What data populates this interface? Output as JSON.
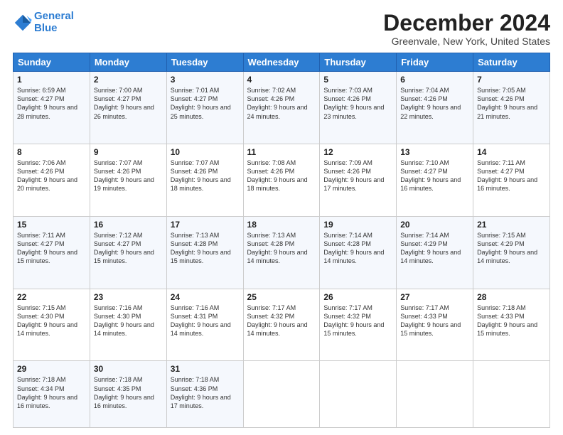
{
  "header": {
    "logo_line1": "General",
    "logo_line2": "Blue",
    "title": "December 2024",
    "subtitle": "Greenvale, New York, United States"
  },
  "weekdays": [
    "Sunday",
    "Monday",
    "Tuesday",
    "Wednesday",
    "Thursday",
    "Friday",
    "Saturday"
  ],
  "weeks": [
    [
      {
        "day": "1",
        "sunrise": "6:59 AM",
        "sunset": "4:27 PM",
        "daylight": "9 hours and 28 minutes."
      },
      {
        "day": "2",
        "sunrise": "7:00 AM",
        "sunset": "4:27 PM",
        "daylight": "9 hours and 26 minutes."
      },
      {
        "day": "3",
        "sunrise": "7:01 AM",
        "sunset": "4:27 PM",
        "daylight": "9 hours and 25 minutes."
      },
      {
        "day": "4",
        "sunrise": "7:02 AM",
        "sunset": "4:26 PM",
        "daylight": "9 hours and 24 minutes."
      },
      {
        "day": "5",
        "sunrise": "7:03 AM",
        "sunset": "4:26 PM",
        "daylight": "9 hours and 23 minutes."
      },
      {
        "day": "6",
        "sunrise": "7:04 AM",
        "sunset": "4:26 PM",
        "daylight": "9 hours and 22 minutes."
      },
      {
        "day": "7",
        "sunrise": "7:05 AM",
        "sunset": "4:26 PM",
        "daylight": "9 hours and 21 minutes."
      }
    ],
    [
      {
        "day": "8",
        "sunrise": "7:06 AM",
        "sunset": "4:26 PM",
        "daylight": "9 hours and 20 minutes."
      },
      {
        "day": "9",
        "sunrise": "7:07 AM",
        "sunset": "4:26 PM",
        "daylight": "9 hours and 19 minutes."
      },
      {
        "day": "10",
        "sunrise": "7:07 AM",
        "sunset": "4:26 PM",
        "daylight": "9 hours and 18 minutes."
      },
      {
        "day": "11",
        "sunrise": "7:08 AM",
        "sunset": "4:26 PM",
        "daylight": "9 hours and 18 minutes."
      },
      {
        "day": "12",
        "sunrise": "7:09 AM",
        "sunset": "4:26 PM",
        "daylight": "9 hours and 17 minutes."
      },
      {
        "day": "13",
        "sunrise": "7:10 AM",
        "sunset": "4:27 PM",
        "daylight": "9 hours and 16 minutes."
      },
      {
        "day": "14",
        "sunrise": "7:11 AM",
        "sunset": "4:27 PM",
        "daylight": "9 hours and 16 minutes."
      }
    ],
    [
      {
        "day": "15",
        "sunrise": "7:11 AM",
        "sunset": "4:27 PM",
        "daylight": "9 hours and 15 minutes."
      },
      {
        "day": "16",
        "sunrise": "7:12 AM",
        "sunset": "4:27 PM",
        "daylight": "9 hours and 15 minutes."
      },
      {
        "day": "17",
        "sunrise": "7:13 AM",
        "sunset": "4:28 PM",
        "daylight": "9 hours and 15 minutes."
      },
      {
        "day": "18",
        "sunrise": "7:13 AM",
        "sunset": "4:28 PM",
        "daylight": "9 hours and 14 minutes."
      },
      {
        "day": "19",
        "sunrise": "7:14 AM",
        "sunset": "4:28 PM",
        "daylight": "9 hours and 14 minutes."
      },
      {
        "day": "20",
        "sunrise": "7:14 AM",
        "sunset": "4:29 PM",
        "daylight": "9 hours and 14 minutes."
      },
      {
        "day": "21",
        "sunrise": "7:15 AM",
        "sunset": "4:29 PM",
        "daylight": "9 hours and 14 minutes."
      }
    ],
    [
      {
        "day": "22",
        "sunrise": "7:15 AM",
        "sunset": "4:30 PM",
        "daylight": "9 hours and 14 minutes."
      },
      {
        "day": "23",
        "sunrise": "7:16 AM",
        "sunset": "4:30 PM",
        "daylight": "9 hours and 14 minutes."
      },
      {
        "day": "24",
        "sunrise": "7:16 AM",
        "sunset": "4:31 PM",
        "daylight": "9 hours and 14 minutes."
      },
      {
        "day": "25",
        "sunrise": "7:17 AM",
        "sunset": "4:32 PM",
        "daylight": "9 hours and 14 minutes."
      },
      {
        "day": "26",
        "sunrise": "7:17 AM",
        "sunset": "4:32 PM",
        "daylight": "9 hours and 15 minutes."
      },
      {
        "day": "27",
        "sunrise": "7:17 AM",
        "sunset": "4:33 PM",
        "daylight": "9 hours and 15 minutes."
      },
      {
        "day": "28",
        "sunrise": "7:18 AM",
        "sunset": "4:33 PM",
        "daylight": "9 hours and 15 minutes."
      }
    ],
    [
      {
        "day": "29",
        "sunrise": "7:18 AM",
        "sunset": "4:34 PM",
        "daylight": "9 hours and 16 minutes."
      },
      {
        "day": "30",
        "sunrise": "7:18 AM",
        "sunset": "4:35 PM",
        "daylight": "9 hours and 16 minutes."
      },
      {
        "day": "31",
        "sunrise": "7:18 AM",
        "sunset": "4:36 PM",
        "daylight": "9 hours and 17 minutes."
      },
      null,
      null,
      null,
      null
    ]
  ],
  "labels": {
    "sunrise": "Sunrise:",
    "sunset": "Sunset:",
    "daylight": "Daylight:"
  }
}
